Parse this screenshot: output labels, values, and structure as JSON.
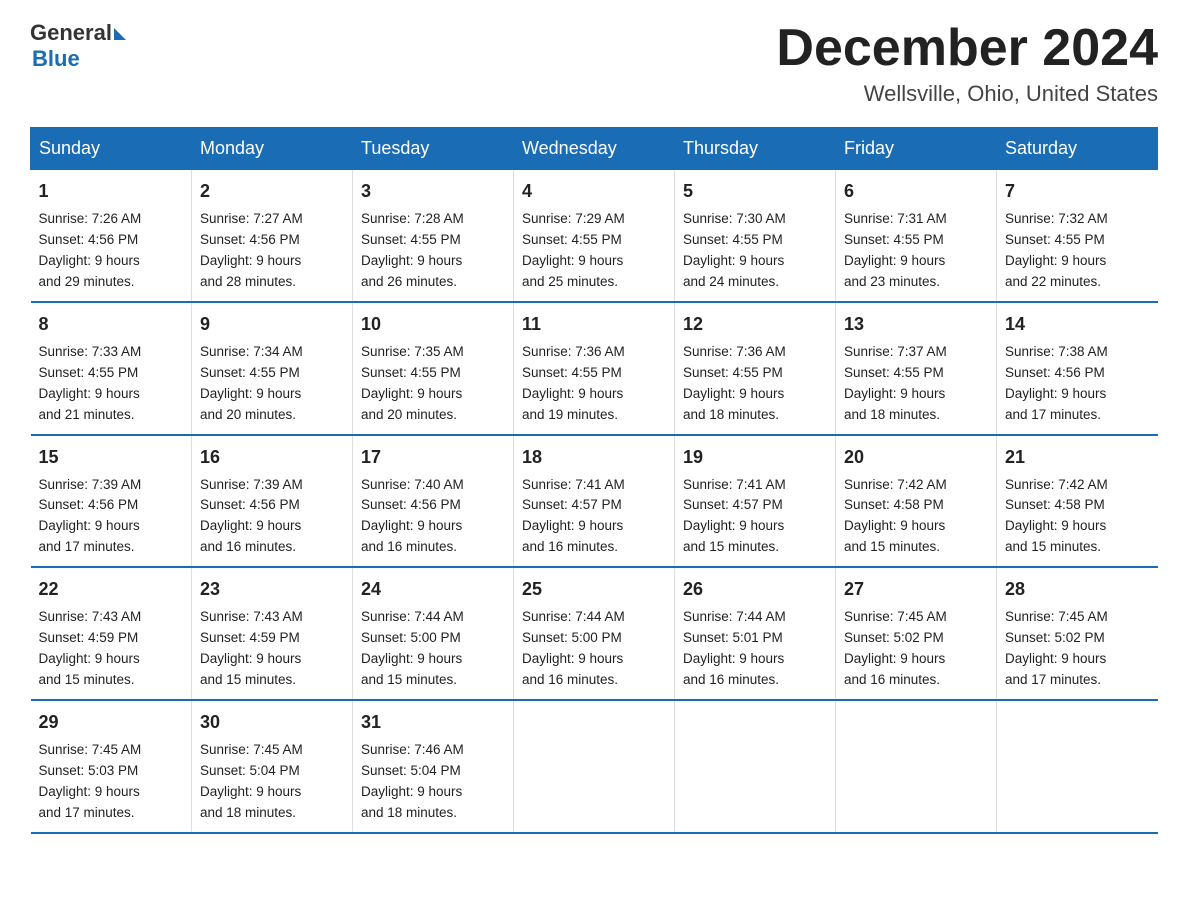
{
  "header": {
    "logo_general": "General",
    "logo_blue": "Blue",
    "month_title": "December 2024",
    "location": "Wellsville, Ohio, United States"
  },
  "days_of_week": [
    "Sunday",
    "Monday",
    "Tuesday",
    "Wednesday",
    "Thursday",
    "Friday",
    "Saturday"
  ],
  "weeks": [
    [
      {
        "day": "1",
        "sunrise": "7:26 AM",
        "sunset": "4:56 PM",
        "daylight": "9 hours and 29 minutes."
      },
      {
        "day": "2",
        "sunrise": "7:27 AM",
        "sunset": "4:56 PM",
        "daylight": "9 hours and 28 minutes."
      },
      {
        "day": "3",
        "sunrise": "7:28 AM",
        "sunset": "4:55 PM",
        "daylight": "9 hours and 26 minutes."
      },
      {
        "day": "4",
        "sunrise": "7:29 AM",
        "sunset": "4:55 PM",
        "daylight": "9 hours and 25 minutes."
      },
      {
        "day": "5",
        "sunrise": "7:30 AM",
        "sunset": "4:55 PM",
        "daylight": "9 hours and 24 minutes."
      },
      {
        "day": "6",
        "sunrise": "7:31 AM",
        "sunset": "4:55 PM",
        "daylight": "9 hours and 23 minutes."
      },
      {
        "day": "7",
        "sunrise": "7:32 AM",
        "sunset": "4:55 PM",
        "daylight": "9 hours and 22 minutes."
      }
    ],
    [
      {
        "day": "8",
        "sunrise": "7:33 AM",
        "sunset": "4:55 PM",
        "daylight": "9 hours and 21 minutes."
      },
      {
        "day": "9",
        "sunrise": "7:34 AM",
        "sunset": "4:55 PM",
        "daylight": "9 hours and 20 minutes."
      },
      {
        "day": "10",
        "sunrise": "7:35 AM",
        "sunset": "4:55 PM",
        "daylight": "9 hours and 20 minutes."
      },
      {
        "day": "11",
        "sunrise": "7:36 AM",
        "sunset": "4:55 PM",
        "daylight": "9 hours and 19 minutes."
      },
      {
        "day": "12",
        "sunrise": "7:36 AM",
        "sunset": "4:55 PM",
        "daylight": "9 hours and 18 minutes."
      },
      {
        "day": "13",
        "sunrise": "7:37 AM",
        "sunset": "4:55 PM",
        "daylight": "9 hours and 18 minutes."
      },
      {
        "day": "14",
        "sunrise": "7:38 AM",
        "sunset": "4:56 PM",
        "daylight": "9 hours and 17 minutes."
      }
    ],
    [
      {
        "day": "15",
        "sunrise": "7:39 AM",
        "sunset": "4:56 PM",
        "daylight": "9 hours and 17 minutes."
      },
      {
        "day": "16",
        "sunrise": "7:39 AM",
        "sunset": "4:56 PM",
        "daylight": "9 hours and 16 minutes."
      },
      {
        "day": "17",
        "sunrise": "7:40 AM",
        "sunset": "4:56 PM",
        "daylight": "9 hours and 16 minutes."
      },
      {
        "day": "18",
        "sunrise": "7:41 AM",
        "sunset": "4:57 PM",
        "daylight": "9 hours and 16 minutes."
      },
      {
        "day": "19",
        "sunrise": "7:41 AM",
        "sunset": "4:57 PM",
        "daylight": "9 hours and 15 minutes."
      },
      {
        "day": "20",
        "sunrise": "7:42 AM",
        "sunset": "4:58 PM",
        "daylight": "9 hours and 15 minutes."
      },
      {
        "day": "21",
        "sunrise": "7:42 AM",
        "sunset": "4:58 PM",
        "daylight": "9 hours and 15 minutes."
      }
    ],
    [
      {
        "day": "22",
        "sunrise": "7:43 AM",
        "sunset": "4:59 PM",
        "daylight": "9 hours and 15 minutes."
      },
      {
        "day": "23",
        "sunrise": "7:43 AM",
        "sunset": "4:59 PM",
        "daylight": "9 hours and 15 minutes."
      },
      {
        "day": "24",
        "sunrise": "7:44 AM",
        "sunset": "5:00 PM",
        "daylight": "9 hours and 15 minutes."
      },
      {
        "day": "25",
        "sunrise": "7:44 AM",
        "sunset": "5:00 PM",
        "daylight": "9 hours and 16 minutes."
      },
      {
        "day": "26",
        "sunrise": "7:44 AM",
        "sunset": "5:01 PM",
        "daylight": "9 hours and 16 minutes."
      },
      {
        "day": "27",
        "sunrise": "7:45 AM",
        "sunset": "5:02 PM",
        "daylight": "9 hours and 16 minutes."
      },
      {
        "day": "28",
        "sunrise": "7:45 AM",
        "sunset": "5:02 PM",
        "daylight": "9 hours and 17 minutes."
      }
    ],
    [
      {
        "day": "29",
        "sunrise": "7:45 AM",
        "sunset": "5:03 PM",
        "daylight": "9 hours and 17 minutes."
      },
      {
        "day": "30",
        "sunrise": "7:45 AM",
        "sunset": "5:04 PM",
        "daylight": "9 hours and 18 minutes."
      },
      {
        "day": "31",
        "sunrise": "7:46 AM",
        "sunset": "5:04 PM",
        "daylight": "9 hours and 18 minutes."
      },
      {
        "day": "",
        "sunrise": "",
        "sunset": "",
        "daylight": ""
      },
      {
        "day": "",
        "sunrise": "",
        "sunset": "",
        "daylight": ""
      },
      {
        "day": "",
        "sunrise": "",
        "sunset": "",
        "daylight": ""
      },
      {
        "day": "",
        "sunrise": "",
        "sunset": "",
        "daylight": ""
      }
    ]
  ],
  "labels": {
    "sunrise": "Sunrise:",
    "sunset": "Sunset:",
    "daylight": "Daylight:"
  }
}
